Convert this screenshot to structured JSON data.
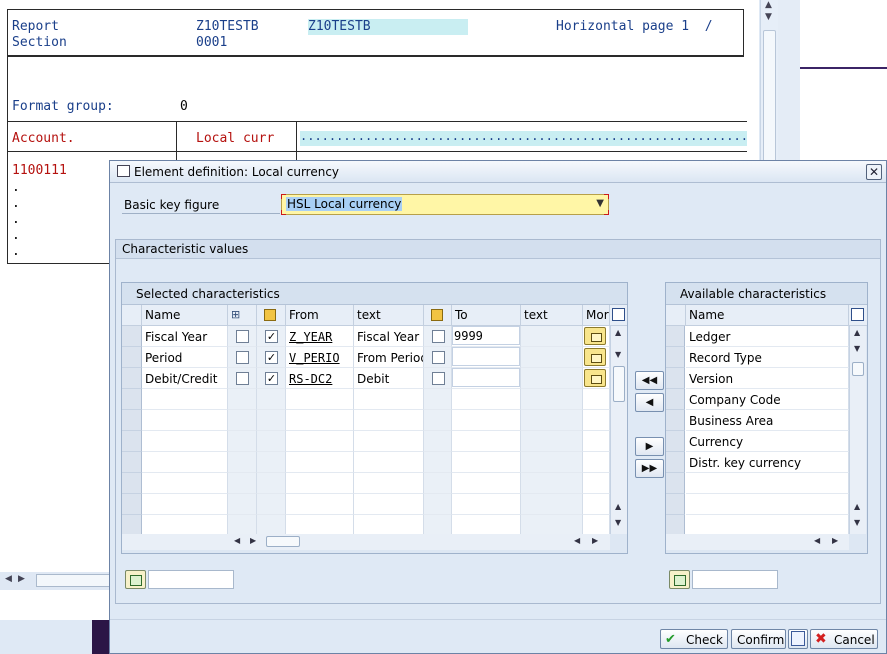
{
  "report": {
    "report_label": "Report",
    "section_label": "Section",
    "report_value": "Z10TESTB",
    "report_value2": "Z10TESTB",
    "section_value": "0001",
    "horizontal_page": "Horizontal page 1  /",
    "format_group_label": "Format group:",
    "format_group_value": "0",
    "col_account": "Account.",
    "col_local_curr": "Local curr",
    "dots_row": "...............................................................",
    "account_value": "1100111",
    "dot": "."
  },
  "dialog": {
    "title": "Element definition: Local currency",
    "close_label": "✕",
    "basic_key_figure_label": "Basic key figure",
    "basic_key_figure_value": "HSL Local currency",
    "char_values_header": "Characteristic values",
    "selected": {
      "title": "Selected characteristics",
      "col_name": "Name",
      "col_from": "From",
      "col_text": "text",
      "col_to": "To",
      "col_text2": "text",
      "col_more": "Mor",
      "rows": [
        {
          "name": "Fiscal Year",
          "checked": true,
          "from": "Z_YEAR",
          "from_text": "Fiscal Year",
          "to": "9999"
        },
        {
          "name": "Period",
          "checked": true,
          "from": "V_PERIO",
          "from_text": "From Period",
          "to": ""
        },
        {
          "name": "Debit/Credit",
          "checked": true,
          "from": "RS-DC2",
          "from_text": "Debit",
          "to": ""
        }
      ]
    },
    "available": {
      "title": "Available characteristics",
      "col_name": "Name",
      "rows": [
        "Ledger",
        "Record Type",
        "Version",
        "Company Code",
        "Business Area",
        "Currency",
        "Distr. key currency"
      ]
    },
    "nav": {
      "add_all": "◀◀",
      "add_one": "◀",
      "remove_one": "▶",
      "remove_all": "▶▶"
    },
    "buttons": {
      "check": "Check",
      "confirm": "Confirm",
      "cancel": "Cancel"
    }
  }
}
